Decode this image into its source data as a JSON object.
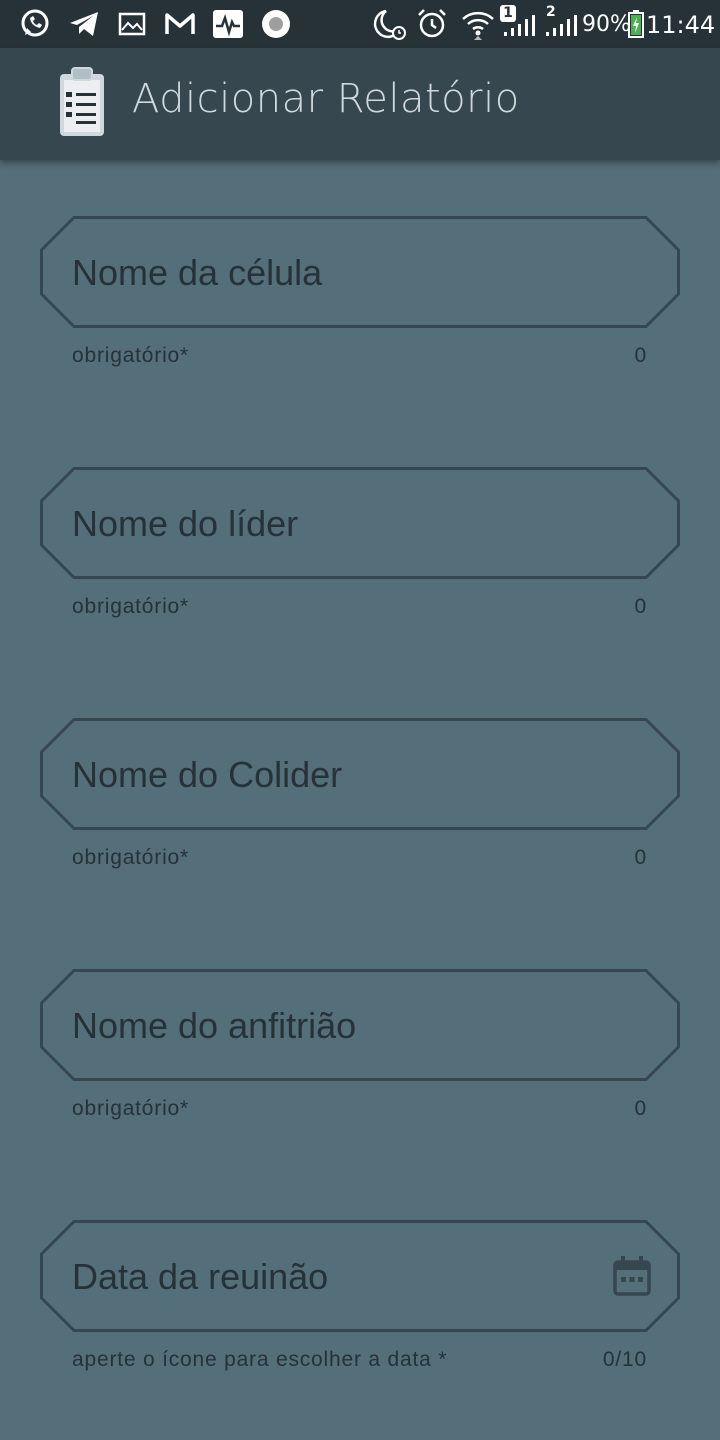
{
  "status_bar": {
    "battery": "90%",
    "time": "11:44",
    "sim1": "1",
    "sim2": "2",
    "icons": [
      "whatsapp-icon",
      "telegram-icon",
      "gallery-icon",
      "gmail-icon",
      "pulse-icon",
      "record-icon",
      "moon-alarm-icon",
      "alarm-icon",
      "wifi-icon",
      "signal-icon",
      "battery-icon"
    ]
  },
  "app_bar": {
    "title": "Adicionar Relatório",
    "icon": "clipboard-icon"
  },
  "form": {
    "fields": [
      {
        "label": "Nome da célula",
        "helper": "obrigatório*",
        "counter": "0"
      },
      {
        "label": "Nome do líder",
        "helper": "obrigatório*",
        "counter": "0"
      },
      {
        "label": "Nome do Colider",
        "helper": "obrigatório*",
        "counter": "0"
      },
      {
        "label": "Nome do anfitrião",
        "helper": "obrigatório*",
        "counter": "0"
      },
      {
        "label": "Data da reuinão",
        "helper": "aperte o ícone para escolher a data *",
        "counter": "0/10",
        "icon": "calendar-icon"
      }
    ]
  },
  "colors": {
    "background": "#546e7a",
    "app_bar": "#37474f",
    "status_bar": "#263238",
    "outline": "#37474f",
    "text": "#263238"
  }
}
